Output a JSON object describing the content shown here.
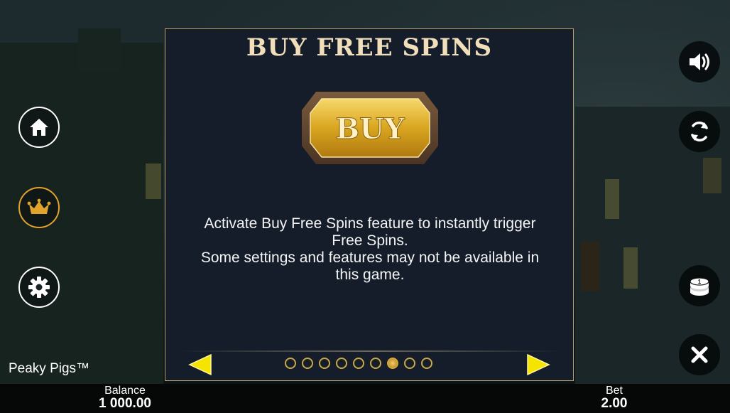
{
  "game": {
    "name": "Peaky Pigs™"
  },
  "panel": {
    "title": "BUY FREE SPINS",
    "button_art_label": "BUY",
    "description_lines": [
      "Activate Buy Free Spins feature to instantly trigger",
      "Free Spins.",
      "Some settings and features may not be available in",
      "this game."
    ],
    "pagination": {
      "total": 9,
      "active_index": 6
    }
  },
  "footer": {
    "balance_label": "Balance",
    "balance_value": "1 000.00",
    "bet_label": "Bet",
    "bet_value": "2.00"
  },
  "left_buttons": [
    {
      "name": "home-button",
      "icon": "home-icon"
    },
    {
      "name": "crown-button",
      "icon": "crown-icon",
      "accent": "#e2a32a"
    },
    {
      "name": "settings-button",
      "icon": "gear-icon"
    }
  ],
  "right_buttons": [
    {
      "name": "sound-button",
      "icon": "speaker-icon"
    },
    {
      "name": "autoplay-button",
      "icon": "refresh-icon"
    },
    {
      "name": "bet-button",
      "icon": "coin-stack-icon"
    },
    {
      "name": "close-button",
      "icon": "close-icon"
    }
  ],
  "colors": {
    "panel_border": "#b9a36a",
    "title": "#f1dfbb",
    "arrow": "#f4e400",
    "dot_outline": "#c9a84a"
  }
}
